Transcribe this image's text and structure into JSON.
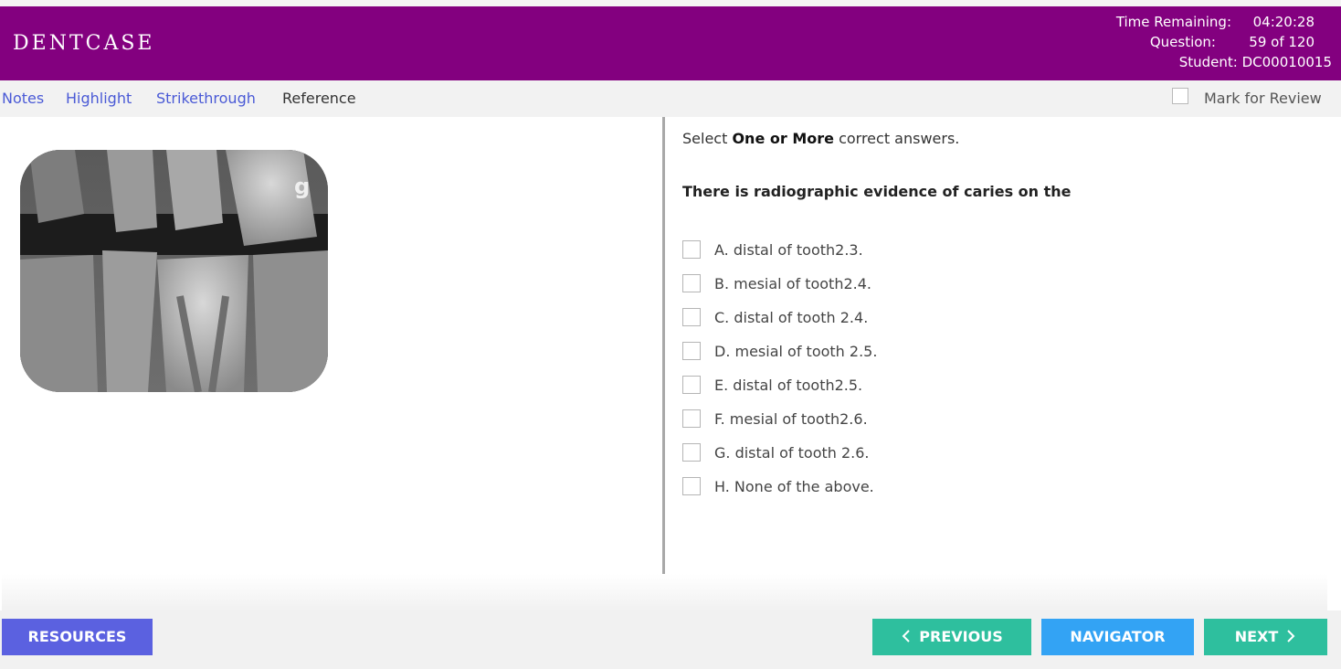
{
  "header": {
    "brand": "DENTCASE",
    "time_label": "Time Remaining:",
    "time_value": "04:20:28",
    "question_label": "Question:",
    "question_value": "59 of 120",
    "student": "Student: DC00010015"
  },
  "toolbar": {
    "notes": "Notes",
    "highlight": "Highlight",
    "strikethrough": "Strikethrough",
    "reference": "Reference",
    "mark_for_review": "Mark for Review"
  },
  "question": {
    "instruction_prefix": "Select ",
    "instruction_bold": "One or More",
    "instruction_suffix": " correct answers.",
    "text": "There is radiographic evidence of caries on the",
    "image_mark": "g",
    "options": [
      "A. distal of tooth2.3.",
      "B. mesial of tooth2.4.",
      "C. distal of tooth 2.4.",
      "D. mesial of tooth 2.5.",
      "E. distal of tooth2.5.",
      "F. mesial of tooth2.6.",
      "G. distal of tooth 2.6.",
      "H. None of the above."
    ]
  },
  "footer": {
    "resources": "RESOURCES",
    "previous": "PREVIOUS",
    "navigator": "NAVIGATOR",
    "next": "NEXT"
  },
  "colors": {
    "header_bg": "#83007f",
    "link": "#4a5ad6",
    "resources_btn": "#5b61e0",
    "nav_green": "#2ebf9e",
    "navigator_btn": "#33a3f4"
  },
  "icons": {
    "previous": "chevron-left-icon",
    "next": "chevron-right-icon"
  }
}
